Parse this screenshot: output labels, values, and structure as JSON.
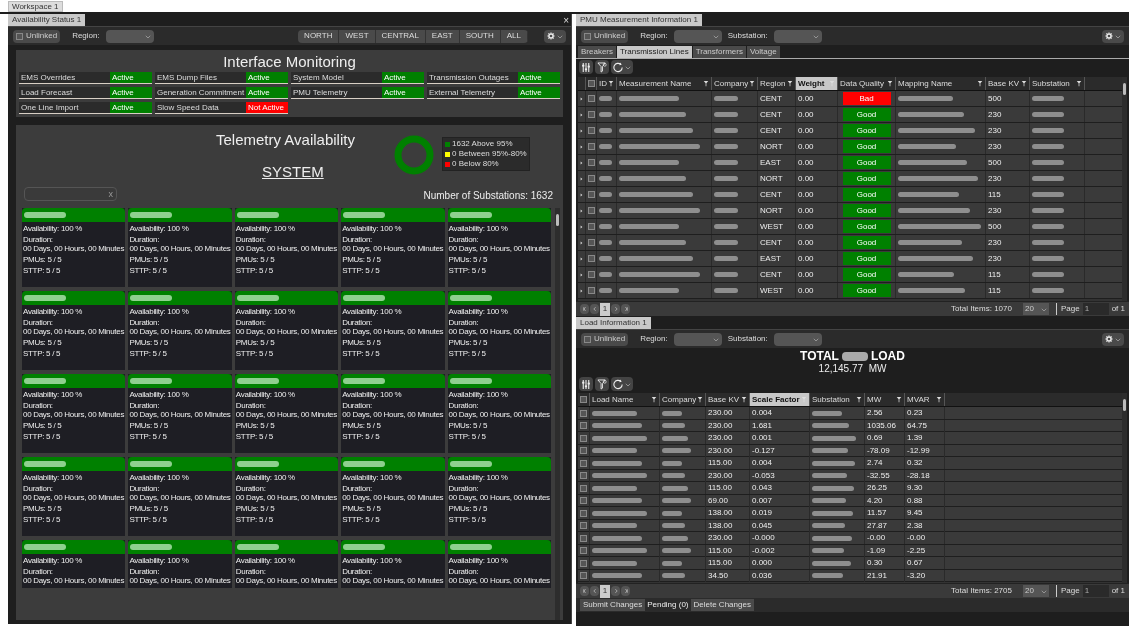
{
  "workspace_tab": "Workspace 1",
  "availability": {
    "tab": "Availability Status 1",
    "close": "×",
    "unlinked": {
      "label": "Unlinked",
      "checked": false
    },
    "region_label": "Region:",
    "region_buttons": [
      {
        "label": "NORTH",
        "selected": false
      },
      {
        "label": "WEST",
        "selected": false
      },
      {
        "label": "CENTRAL",
        "selected": false
      },
      {
        "label": "EAST",
        "selected": false
      },
      {
        "label": "SOUTH",
        "selected": false
      },
      {
        "label": "ALL",
        "selected": false
      }
    ],
    "interface": {
      "title": "Interface Monitoring",
      "items": [
        {
          "label": "EMS Overrides",
          "status": "Active",
          "active": true
        },
        {
          "label": "EMS Dump Files",
          "status": "Active",
          "active": true
        },
        {
          "label": "System Model",
          "status": "Active",
          "active": true
        },
        {
          "label": "Transmission Outages",
          "status": "Active",
          "active": true
        },
        {
          "label": "Load Forecast",
          "status": "Active",
          "active": true
        },
        {
          "label": "Generation Commitment",
          "status": "Active",
          "active": true
        },
        {
          "label": "PMU Telemetry",
          "status": "Active",
          "active": true
        },
        {
          "label": "External Telemetry",
          "status": "Active",
          "active": true
        },
        {
          "label": "One Line Import",
          "status": "Active",
          "active": true
        },
        {
          "label": "Slow Speed Data",
          "status": "Not Active",
          "active": false
        }
      ]
    },
    "telemetry": {
      "title": "Telemetry Availability",
      "scope": "SYSTEM",
      "legend": [
        {
          "label": "1632 Above 95%",
          "color": "#008000"
        },
        {
          "label": "0 Between 95%-80%",
          "color": "#ffff00"
        },
        {
          "label": "0 Below 80%",
          "color": "#ff0000"
        }
      ],
      "search_clear": "x",
      "substations": "Number of Substations: 1632",
      "cards": [
        {
          "availability": "Availability: 100 %",
          "duration_label": "Duration:",
          "duration": "00 Days, 00 Hours, 00 Minutes",
          "pmus": "PMUs: 5 / 5",
          "sttp": "STTP: 5 / 5"
        },
        {
          "availability": "Availability: 100 %",
          "duration_label": "Duration:",
          "duration": "00 Days, 00 Hours, 00 Minutes",
          "pmus": "PMUs: 5 / 5",
          "sttp": "STTP: 5 / 5"
        },
        {
          "availability": "Availability: 100 %",
          "duration_label": "Duration:",
          "duration": "00 Days, 00 Hours, 00 Minutes",
          "pmus": "PMUs: 5 / 5",
          "sttp": "STTP: 5 / 5"
        },
        {
          "availability": "Availability: 100 %",
          "duration_label": "Duration:",
          "duration": "00 Days, 00 Hours, 00 Minutes",
          "pmus": "PMUs: 5 / 5",
          "sttp": "STTP: 5 / 5"
        },
        {
          "availability": "Availability: 100 %",
          "duration_label": "Duration:",
          "duration": "00 Days, 00 Hours, 00 Minutes",
          "pmus": "PMUs: 5 / 5",
          "sttp": "STTP: 5 / 5"
        },
        {
          "availability": "Availability: 100 %",
          "duration_label": "Duration:",
          "duration": "00 Days, 00 Hours, 00 Minutes",
          "pmus": "PMUs: 5 / 5",
          "sttp": "STTP: 5 / 5"
        },
        {
          "availability": "Availability: 100 %",
          "duration_label": "Duration:",
          "duration": "00 Days, 00 Hours, 00 Minutes",
          "pmus": "PMUs: 5 / 5",
          "sttp": "STTP: 5 / 5"
        },
        {
          "availability": "Availability: 100 %",
          "duration_label": "Duration:",
          "duration": "00 Days, 00 Hours, 00 Minutes",
          "pmus": "PMUs: 5 / 5",
          "sttp": "STTP: 5 / 5"
        },
        {
          "availability": "Availability: 100 %",
          "duration_label": "Duration:",
          "duration": "00 Days, 00 Hours, 00 Minutes",
          "pmus": "PMUs: 5 / 5",
          "sttp": "STTP: 5 / 5"
        },
        {
          "availability": "Availability: 100 %",
          "duration_label": "Duration:",
          "duration": "00 Days, 00 Hours, 00 Minutes",
          "pmus": "PMUs: 5 / 5",
          "sttp": "STTP: 5 / 5"
        },
        {
          "availability": "Availability: 100 %",
          "duration_label": "Duration:",
          "duration": "00 Days, 00 Hours, 00 Minutes",
          "pmus": "PMUs: 5 / 5",
          "sttp": "STTP: 5 / 5"
        },
        {
          "availability": "Availability: 100 %",
          "duration_label": "Duration:",
          "duration": "00 Days, 00 Hours, 00 Minutes",
          "pmus": "PMUs: 5 / 5",
          "sttp": "STTP: 5 / 5"
        },
        {
          "availability": "Availability: 100 %",
          "duration_label": "Duration:",
          "duration": "00 Days, 00 Hours, 00 Minutes",
          "pmus": "PMUs: 5 / 5",
          "sttp": "STTP: 5 / 5"
        },
        {
          "availability": "Availability: 100 %",
          "duration_label": "Duration:",
          "duration": "00 Days, 00 Hours, 00 Minutes",
          "pmus": "PMUs: 5 / 5",
          "sttp": "STTP: 5 / 5"
        },
        {
          "availability": "Availability: 100 %",
          "duration_label": "Duration:",
          "duration": "00 Days, 00 Hours, 00 Minutes",
          "pmus": "PMUs: 5 / 5",
          "sttp": "STTP: 5 / 5"
        },
        {
          "availability": "Availability: 100 %",
          "duration_label": "Duration:",
          "duration": "00 Days, 00 Hours, 00 Minutes",
          "pmus": "PMUs: 5 / 5",
          "sttp": "STTP: 5 / 5"
        },
        {
          "availability": "Availability: 100 %",
          "duration_label": "Duration:",
          "duration": "00 Days, 00 Hours, 00 Minutes",
          "pmus": "PMUs: 5 / 5",
          "sttp": "STTP: 5 / 5"
        },
        {
          "availability": "Availability: 100 %",
          "duration_label": "Duration:",
          "duration": "00 Days, 00 Hours, 00 Minutes",
          "pmus": "PMUs: 5 / 5",
          "sttp": "STTP: 5 / 5"
        },
        {
          "availability": "Availability: 100 %",
          "duration_label": "Duration:",
          "duration": "00 Days, 00 Hours, 00 Minutes",
          "pmus": "PMUs: 5 / 5",
          "sttp": "STTP: 5 / 5"
        },
        {
          "availability": "Availability: 100 %",
          "duration_label": "Duration:",
          "duration": "00 Days, 00 Hours, 00 Minutes",
          "pmus": "PMUs: 5 / 5",
          "sttp": "STTP: 5 / 5"
        },
        {
          "availability": "Availability: 100 %",
          "duration_label": "Duration:",
          "duration": "00 Days, 00 Hours, 00 Minutes"
        },
        {
          "availability": "Availability: 100 %",
          "duration_label": "Duration:",
          "duration": "00 Days, 00 Hours, 00 Minutes"
        },
        {
          "availability": "Availability: 100 %",
          "duration_label": "Duration:",
          "duration": "00 Days, 00 Hours, 00 Minutes"
        },
        {
          "availability": "Availability: 100 %",
          "duration_label": "Duration:",
          "duration": "00 Days, 00 Hours, 00 Minutes"
        },
        {
          "availability": "Availability: 100 %",
          "duration_label": "Duration:",
          "duration": "00 Days, 00 Hours, 00 Minutes"
        }
      ]
    }
  },
  "pmu": {
    "tab": "PMU Measurement Information 1",
    "unlinked": {
      "label": "Unlinked",
      "checked": false
    },
    "region_label": "Region:",
    "substation_label": "Substation:",
    "tabs": [
      {
        "label": "Breakers",
        "selected": false
      },
      {
        "label": "Transmission Lines",
        "selected": true
      },
      {
        "label": "Transformers",
        "selected": false
      },
      {
        "label": "Voltage",
        "selected": false
      }
    ],
    "select_all": {
      "checked": false
    },
    "columns": [
      {
        "label": "ID",
        "highlighted": false
      },
      {
        "label": "Measurement Name",
        "highlighted": false
      },
      {
        "label": "Company",
        "highlighted": false
      },
      {
        "label": "Region",
        "highlighted": false
      },
      {
        "label": "Weight",
        "highlighted": true
      },
      {
        "label": "Data Quality",
        "highlighted": false
      },
      {
        "label": "Mapping Name",
        "highlighted": false
      },
      {
        "label": "Base KV",
        "highlighted": false
      },
      {
        "label": "Substation",
        "highlighted": false
      }
    ],
    "rows": [
      {
        "checked": false,
        "region": "CENT",
        "weight": "0.00",
        "quality": "Bad",
        "ok": false,
        "base_kv": "500"
      },
      {
        "checked": false,
        "region": "CENT",
        "weight": "0.00",
        "quality": "Good",
        "ok": true,
        "base_kv": "230"
      },
      {
        "checked": false,
        "region": "CENT",
        "weight": "0.00",
        "quality": "Good",
        "ok": true,
        "base_kv": "230"
      },
      {
        "checked": false,
        "region": "NORT",
        "weight": "0.00",
        "quality": "Good",
        "ok": true,
        "base_kv": "230"
      },
      {
        "checked": false,
        "region": "EAST",
        "weight": "0.00",
        "quality": "Good",
        "ok": true,
        "base_kv": "500"
      },
      {
        "checked": false,
        "region": "NORT",
        "weight": "0.00",
        "quality": "Good",
        "ok": true,
        "base_kv": "230"
      },
      {
        "checked": false,
        "region": "CENT",
        "weight": "0.00",
        "quality": "Good",
        "ok": true,
        "base_kv": "115"
      },
      {
        "checked": false,
        "region": "NORT",
        "weight": "0.00",
        "quality": "Good",
        "ok": true,
        "base_kv": "230"
      },
      {
        "checked": false,
        "region": "WEST",
        "weight": "0.00",
        "quality": "Good",
        "ok": true,
        "base_kv": "500"
      },
      {
        "checked": false,
        "region": "CENT",
        "weight": "0.00",
        "quality": "Good",
        "ok": true,
        "base_kv": "230"
      },
      {
        "checked": false,
        "region": "EAST",
        "weight": "0.00",
        "quality": "Good",
        "ok": true,
        "base_kv": "230"
      },
      {
        "checked": false,
        "region": "CENT",
        "weight": "0.00",
        "quality": "Good",
        "ok": true,
        "base_kv": "115"
      },
      {
        "checked": false,
        "region": "WEST",
        "weight": "0.00",
        "quality": "Good",
        "ok": true,
        "base_kv": "115"
      }
    ],
    "pager": {
      "page": "1",
      "total": "Total Items: 1070",
      "page_size": "20",
      "page_label": "Page",
      "page_value": "1",
      "of": "of 1"
    }
  },
  "load": {
    "tab": "Load Information 1",
    "unlinked": {
      "label": "Unlinked",
      "checked": false
    },
    "region_label": "Region:",
    "substation_label": "Substation:",
    "title_prefix": "TOTAL",
    "title_suffix": "LOAD",
    "total": "12,145.77  MW",
    "select_all": {
      "checked": false
    },
    "columns": [
      {
        "label": "Load Name",
        "highlighted": false
      },
      {
        "label": "Company",
        "highlighted": false
      },
      {
        "label": "Base KV",
        "highlighted": false
      },
      {
        "label": "Scale Factor",
        "highlighted": true
      },
      {
        "label": "Substation",
        "highlighted": false
      },
      {
        "label": "MW",
        "highlighted": false
      },
      {
        "label": "MVAR",
        "highlighted": false
      }
    ],
    "rows": [
      {
        "checked": false,
        "base_kv": "230.00",
        "scale": "0.004",
        "mw": "2.56",
        "mvar": "0.23"
      },
      {
        "checked": false,
        "base_kv": "230.00",
        "scale": "1.681",
        "mw": "1035.06",
        "mvar": "64.75"
      },
      {
        "checked": false,
        "base_kv": "230.00",
        "scale": "0.001",
        "mw": "0.69",
        "mvar": "1.39"
      },
      {
        "checked": false,
        "base_kv": "230.00",
        "scale": "-0.127",
        "mw": "-78.09",
        "mvar": "-12.99"
      },
      {
        "checked": false,
        "base_kv": "115.00",
        "scale": "0.004",
        "mw": "2.74",
        "mvar": "0.32"
      },
      {
        "checked": false,
        "base_kv": "230.00",
        "scale": "-0.053",
        "mw": "-32.55",
        "mvar": "-28.18"
      },
      {
        "checked": false,
        "base_kv": "115.00",
        "scale": "0.043",
        "mw": "26.25",
        "mvar": "9.30"
      },
      {
        "checked": false,
        "base_kv": "69.00",
        "scale": "0.007",
        "mw": "4.20",
        "mvar": "0.88"
      },
      {
        "checked": false,
        "base_kv": "138.00",
        "scale": "0.019",
        "mw": "11.57",
        "mvar": "9.45"
      },
      {
        "checked": false,
        "base_kv": "138.00",
        "scale": "0.045",
        "mw": "27.87",
        "mvar": "2.38"
      },
      {
        "checked": false,
        "base_kv": "230.00",
        "scale": "-0.000",
        "mw": "-0.00",
        "mvar": "-0.00"
      },
      {
        "checked": false,
        "base_kv": "115.00",
        "scale": "-0.002",
        "mw": "-1.09",
        "mvar": "-2.25"
      },
      {
        "checked": false,
        "base_kv": "115.00",
        "scale": "0.000",
        "mw": "0.30",
        "mvar": "0.67"
      },
      {
        "checked": false,
        "base_kv": "34.50",
        "scale": "0.036",
        "mw": "21.91",
        "mvar": "-3.20"
      }
    ],
    "pager": {
      "page": "1",
      "total": "Total Items: 2705",
      "page_size": "20",
      "page_label": "Page",
      "page_value": "1",
      "of": "of 1"
    },
    "submit": "Submit Changes",
    "pending": "Pending (0)",
    "delete": "Delete Changes"
  }
}
